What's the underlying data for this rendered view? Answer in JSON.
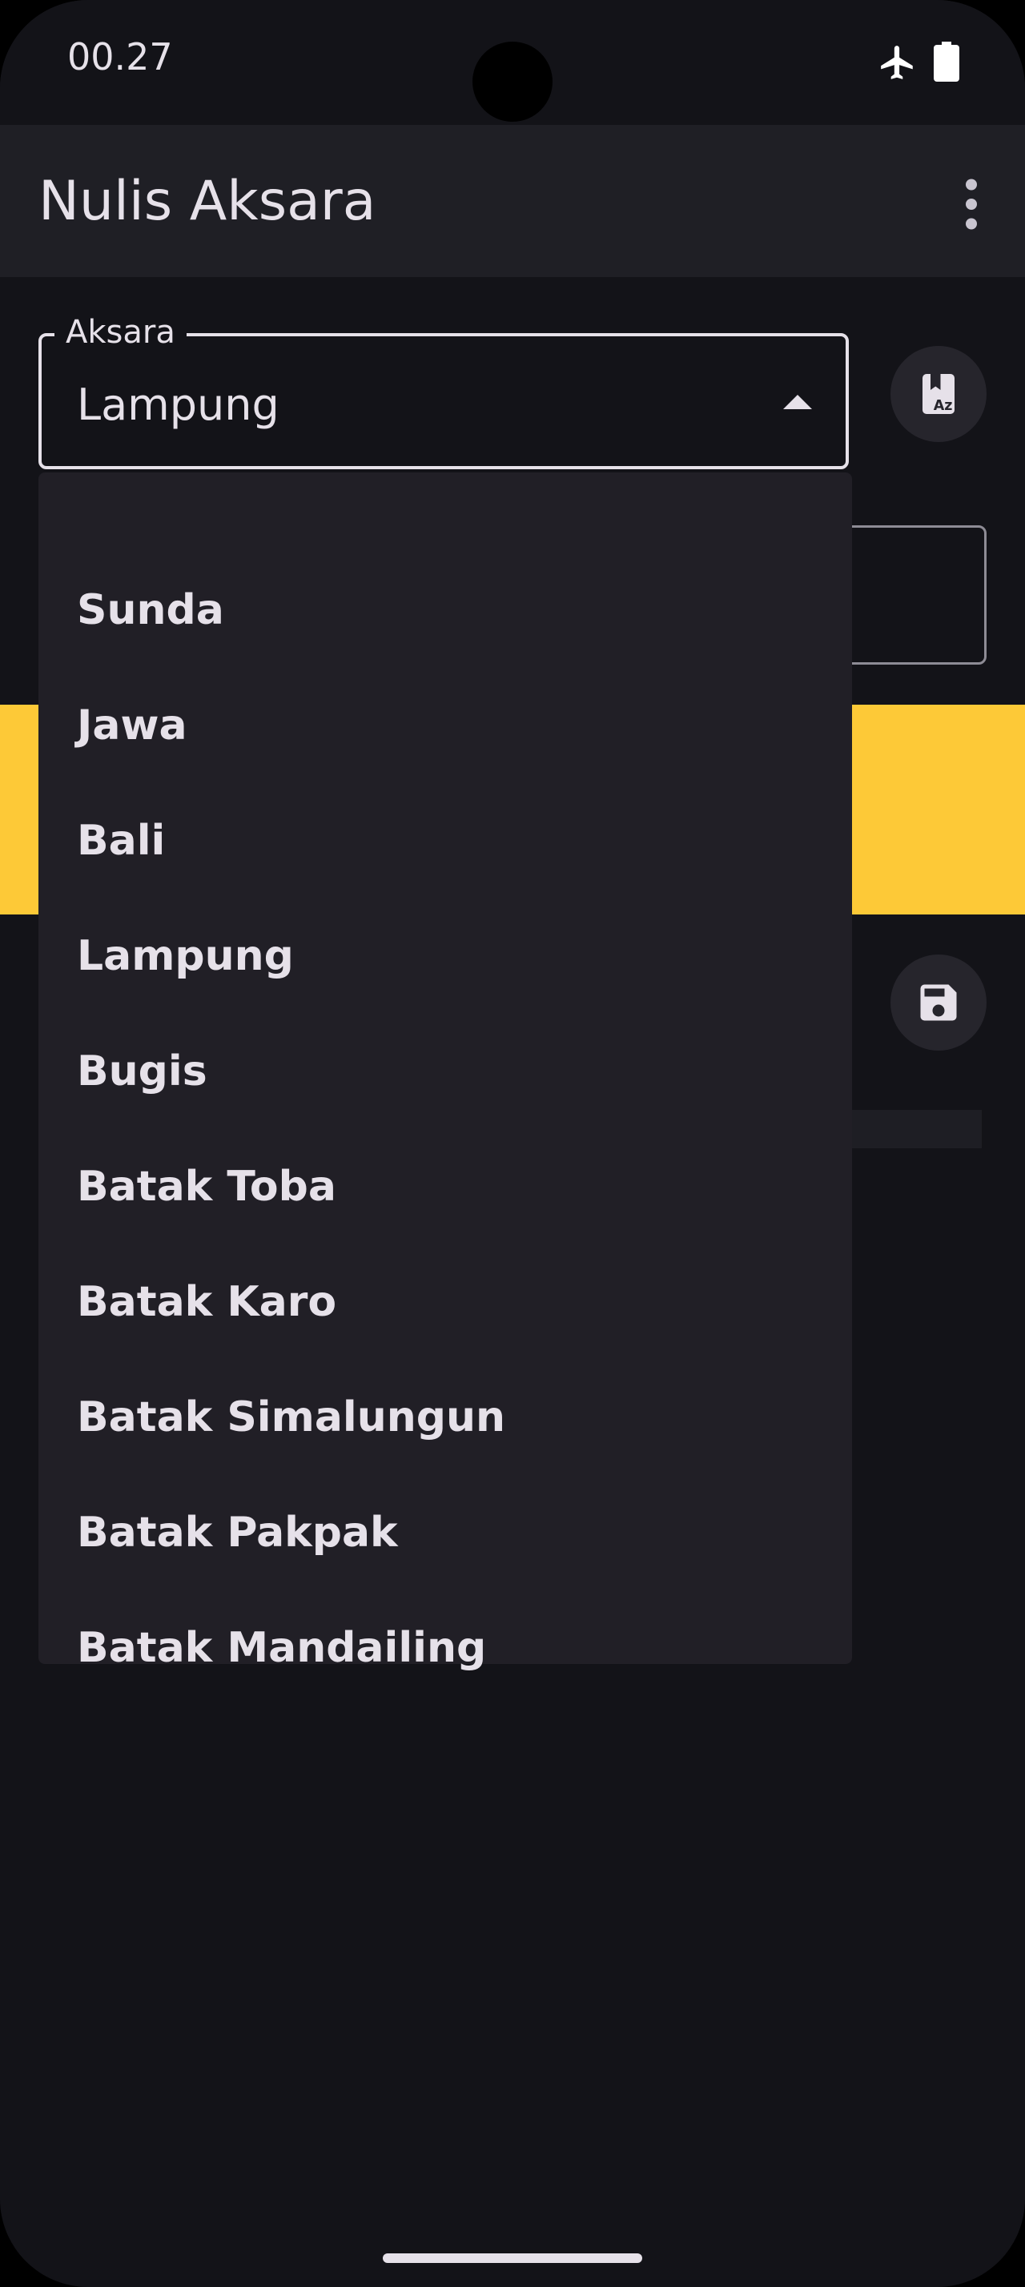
{
  "status_bar": {
    "time": "00.27"
  },
  "app_bar": {
    "title": "Nulis Aksara"
  },
  "aksara_select": {
    "label": "Aksara",
    "value": "Lampung",
    "options": [
      "Sunda",
      "Jawa",
      "Bali",
      "Lampung",
      "Bugis",
      "Batak Toba",
      "Batak Karo",
      "Batak Simalungun",
      "Batak Pakpak",
      "Batak Mandailing"
    ]
  },
  "colors": {
    "background": "#131318",
    "surface": "#211f26",
    "accent": "#fdc937",
    "text": "#e6e1e9"
  },
  "icons": {
    "dictionary_button": "dictionary-az-icon",
    "save_button": "floppy-disk-icon",
    "menu": "more-vert-icon"
  }
}
